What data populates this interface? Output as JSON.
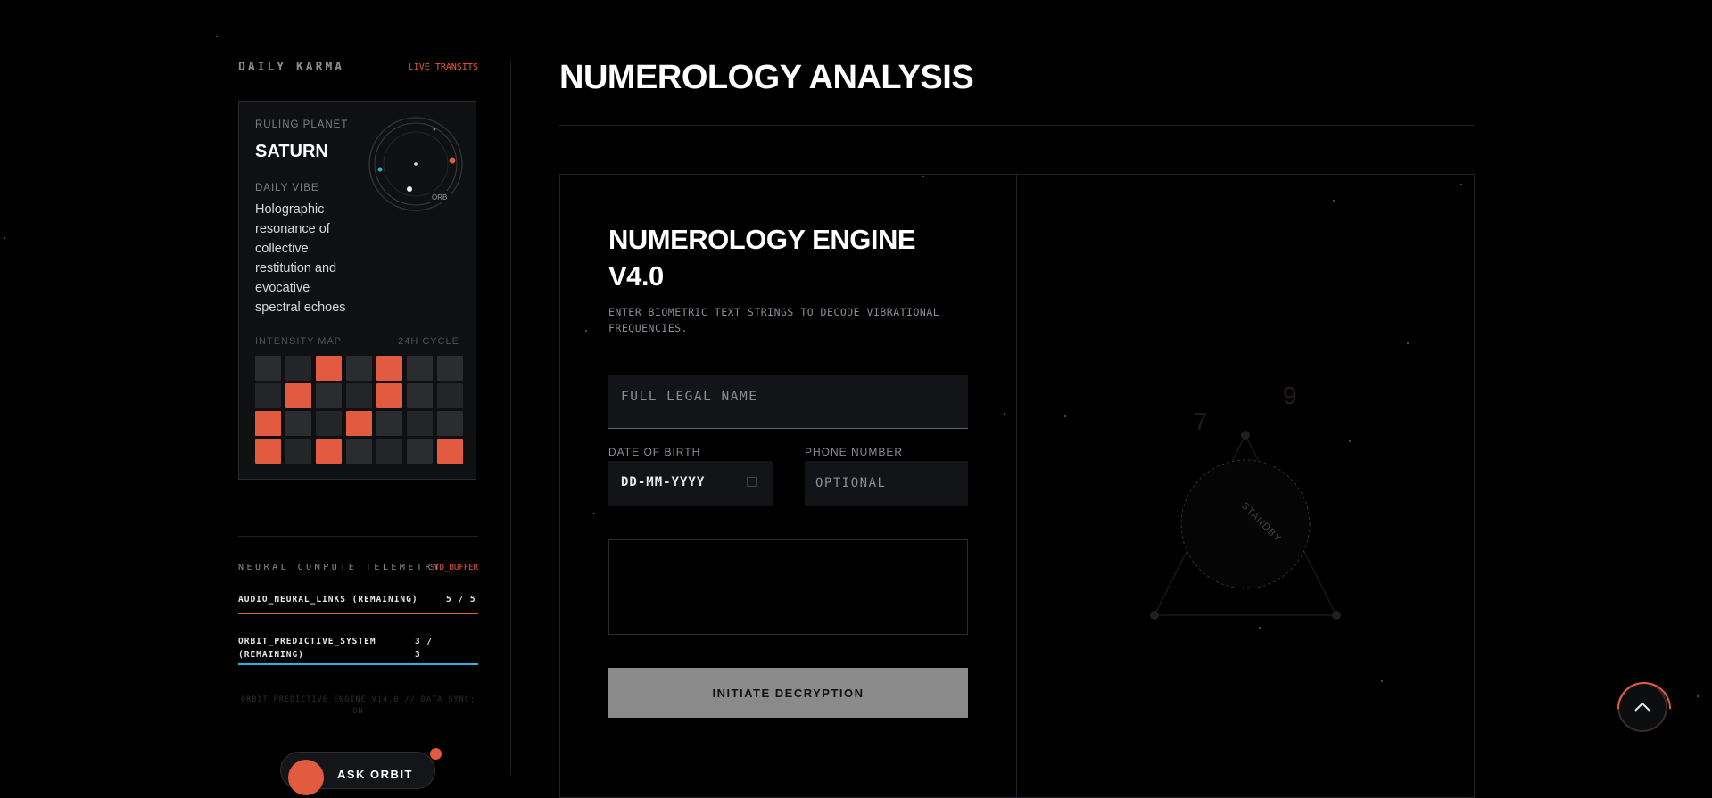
{
  "sidebar": {
    "title": "DAILY KARMA",
    "live_label": "LIVE TRANSITS",
    "card": {
      "ruling_planet_label": "RULING PLANET",
      "ruling_planet": "SATURN",
      "daily_vibe_label": "DAILY VIBE",
      "daily_vibe": "Holographic resonance of collective restitution and evocative spectral echoes",
      "orbit_tag": "ORB",
      "intensity_map_label": "INTENSITY MAP",
      "cycle_label": "24H CYCLE",
      "intensity_grid": [
        [
          0,
          0,
          1,
          0,
          1,
          0,
          0
        ],
        [
          0,
          1,
          0,
          0,
          1,
          0,
          0
        ],
        [
          1,
          0,
          0,
          1,
          0,
          0,
          0
        ],
        [
          1,
          0,
          1,
          0,
          0,
          0,
          1
        ]
      ]
    },
    "telemetry": {
      "title": "NEURAL COMPUTE TELEMETRY",
      "buffer_label": "STD_BUFFER",
      "rows": [
        {
          "label": "AUDIO_NEURAL_LINKS (REMAINING)",
          "value": "5 / 5",
          "fraction": 1.0,
          "color": "#e25a3f"
        },
        {
          "label": "ORBIT_PREDICTIVE_SYSTEM (REMAINING)",
          "value": "3 / 3",
          "fraction": 1.0,
          "color": "#2bb3d6"
        }
      ]
    },
    "footer_note": "ORBIT PREDICTIVE ENGINE V14.0 // DATA_SYNC: ON",
    "ask_button": "ASK ORBIT"
  },
  "main": {
    "page_title": "NUMEROLOGY ANALYSIS",
    "engine_title": "NUMEROLOGY ENGINE V4.0",
    "engine_subtitle": "ENTER BIOMETRIC TEXT STRINGS TO DECODE VIBRATIONAL FREQUENCIES.",
    "name_placeholder": "FULL LEGAL NAME",
    "dob_label": "DATE OF BIRTH",
    "dob_value": "DD-MM-YYYY",
    "phone_label": "PHONE NUMBER",
    "phone_placeholder": "OPTIONAL",
    "submit_label": "INITIATE DECRYPTION",
    "viz_status": "STANDBY",
    "viz_numbers": [
      "7",
      "9"
    ]
  },
  "colors": {
    "accent": "#e25a3f",
    "cyan": "#2bb3d6",
    "background": "#000000"
  }
}
